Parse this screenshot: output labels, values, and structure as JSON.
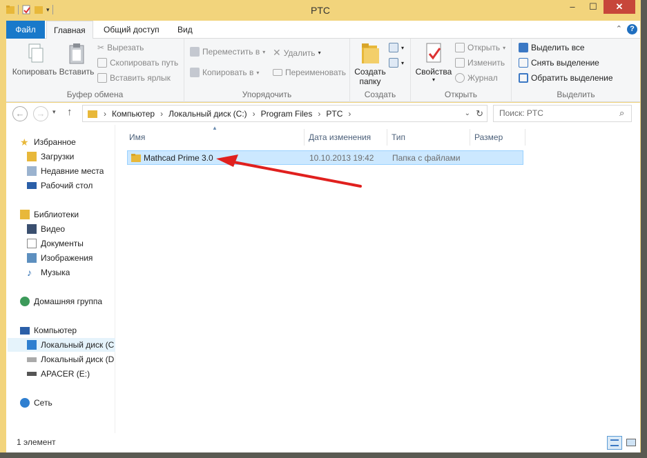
{
  "window": {
    "title": "PTC",
    "min": "–",
    "max": "☐",
    "close": "✕"
  },
  "tabs": [
    "Файл",
    "Главная",
    "Общий доступ",
    "Вид"
  ],
  "ribbon": {
    "clipboard": {
      "copy": "Копировать",
      "paste": "Вставить",
      "cut": "Вырезать",
      "copy_path": "Скопировать путь",
      "paste_shortcut": "Вставить ярлык",
      "label": "Буфер обмена"
    },
    "organize": {
      "move_to": "Переместить в",
      "copy_to": "Копировать в",
      "delete": "Удалить",
      "rename": "Переименовать",
      "label": "Упорядочить"
    },
    "create": {
      "new_folder_l1": "Создать",
      "new_folder_l2": "папку",
      "label": "Создать"
    },
    "open": {
      "properties": "Свойства",
      "open": "Открыть",
      "edit": "Изменить",
      "history": "Журнал",
      "label": "Открыть"
    },
    "select": {
      "select_all": "Выделить все",
      "select_none": "Снять выделение",
      "invert": "Обратить выделение",
      "label": "Выделить"
    }
  },
  "address": {
    "parts": [
      "Компьютер",
      "Локальный диск (C:)",
      "Program Files",
      "PTC"
    ],
    "search_placeholder": "Поиск: PTC"
  },
  "navpane": {
    "favorites": "Избранное",
    "downloads": "Загрузки",
    "recent": "Недавние места",
    "desktop": "Рабочий стол",
    "libraries": "Библиотеки",
    "video": "Видео",
    "documents": "Документы",
    "images": "Изображения",
    "music": "Музыка",
    "homegroup": "Домашняя группа",
    "computer": "Компьютер",
    "disk_c": "Локальный диск (C",
    "disk_d": "Локальный диск (D",
    "apacer": "APACER (E:)",
    "network": "Сеть"
  },
  "columns": [
    "Имя",
    "Дата изменения",
    "Тип",
    "Размер"
  ],
  "files": [
    {
      "name": "Mathcad Prime 3.0",
      "date": "10.10.2013 19:42",
      "type": "Папка с файлами",
      "size": ""
    }
  ],
  "status": {
    "count": "1 элемент"
  },
  "colors": {
    "file_tab": "#1979ca",
    "selection": "#cce8ff",
    "arrow": "#e0201e"
  }
}
